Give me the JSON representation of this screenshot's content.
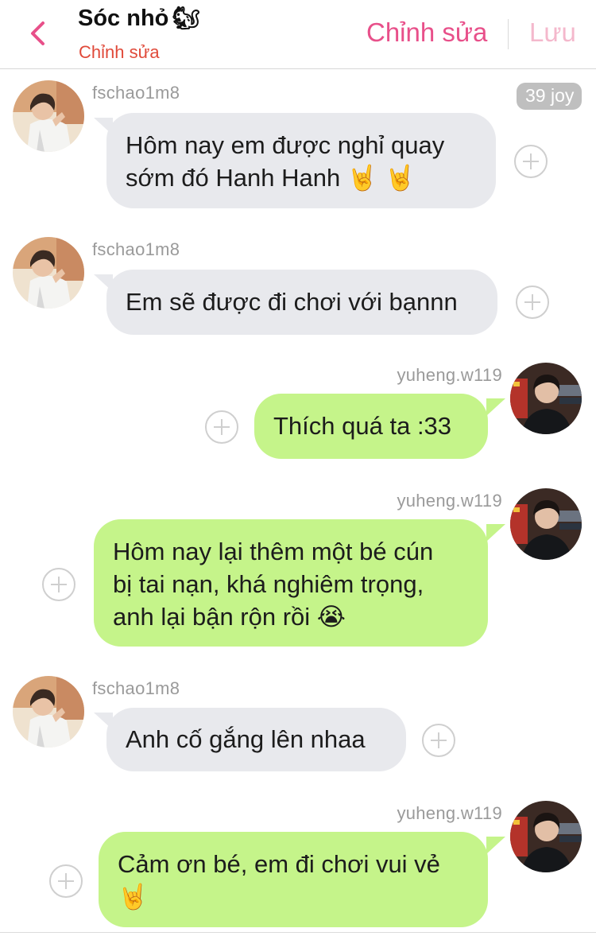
{
  "header": {
    "title": "Sóc nhỏ",
    "title_emoji": "🐿",
    "subtitle": "Chỉnh sửa",
    "edit_label": "Chỉnh sửa",
    "save_label": "Lưu",
    "back_icon": "chevron-left-icon"
  },
  "colors": {
    "accent": "#e8508a",
    "accent_disabled": "#f4b8cc",
    "subtitle": "#e04a3a",
    "incoming_bubble": "#e8e9ed",
    "outgoing_bubble": "#c5f48a"
  },
  "badge": "39 joy",
  "messages": [
    {
      "side": "left",
      "user": "fschao1m8",
      "lines": [
        "Hôm nay em được nghỉ quay",
        "sớm đó Hanh Hanh 🤘 🤘"
      ]
    },
    {
      "side": "left",
      "user": "fschao1m8",
      "lines": [
        "Em sẽ được đi chơi với bạnnn"
      ]
    },
    {
      "side": "right",
      "user": "yuheng.w119",
      "lines": [
        "Thích quá ta :33"
      ]
    },
    {
      "side": "right",
      "user": "yuheng.w119",
      "lines": [
        "Hôm nay lại thêm một bé cún",
        "bị tai nạn, khá nghiêm trọng,",
        "anh lại bận rộn rồi 😭"
      ]
    },
    {
      "side": "left",
      "user": "fschao1m8",
      "lines": [
        "Anh cố gắng lên nhaa"
      ]
    },
    {
      "side": "right",
      "user": "yuheng.w119",
      "lines": [
        "Cảm ơn bé, em đi chơi vui vẻ",
        "🤘"
      ]
    }
  ]
}
